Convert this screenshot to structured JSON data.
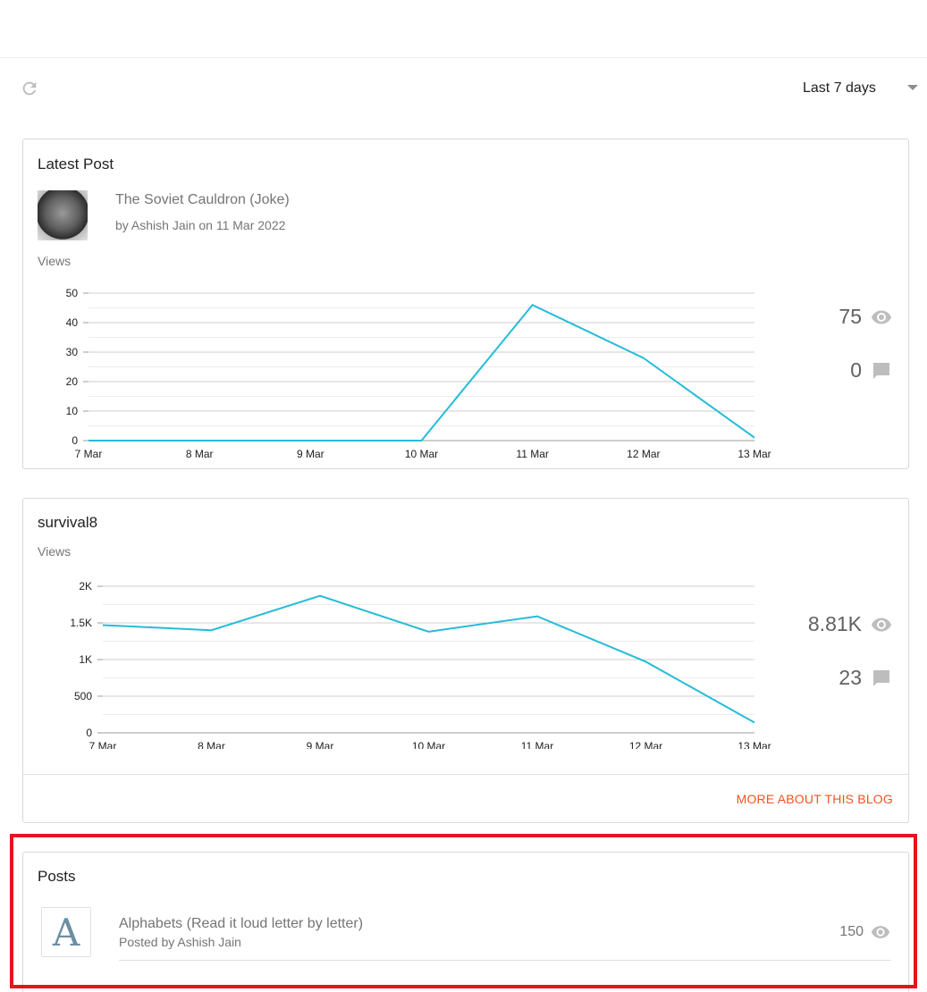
{
  "toolbar": {
    "refresh_icon": "refresh-icon",
    "date_range": "Last 7 days"
  },
  "latest_post": {
    "card_title": "Latest Post",
    "post_title": "The Soviet Cauldron (Joke)",
    "post_meta": "by Ashish Jain on 11 Mar 2022",
    "views_label": "Views",
    "total_views": "75",
    "total_comments": "0"
  },
  "blog": {
    "card_title": "survival8",
    "views_label": "Views",
    "total_views": "8.81K",
    "total_comments": "23",
    "more_link": "More about this blog"
  },
  "posts": {
    "card_title": "Posts",
    "avatar_letter": "A",
    "items": [
      {
        "title": "Alphabets (Read it loud letter by letter)",
        "meta": "Posted by Ashish Jain",
        "views": "150"
      }
    ]
  },
  "colors": {
    "line": "#26bcd7",
    "accent_link": "#f4511e",
    "highlight": "#e3141e"
  },
  "chart_data": [
    {
      "type": "line",
      "categories": [
        "7 Mar",
        "8 Mar",
        "9 Mar",
        "10 Mar",
        "11 Mar",
        "12 Mar",
        "13 Mar"
      ],
      "series": [
        {
          "values": [
            0,
            0,
            0,
            0,
            46,
            28,
            1
          ]
        }
      ],
      "ylabel": "Views",
      "ylim": [
        0,
        50
      ],
      "yticks": [
        0,
        10,
        20,
        30,
        40,
        50
      ],
      "ytick_labels": [
        "0",
        "10",
        "20",
        "30",
        "40",
        "50"
      ],
      "grid": true
    },
    {
      "type": "line",
      "categories": [
        "7 Mar",
        "8 Mar",
        "9 Mar",
        "10 Mar",
        "11 Mar",
        "12 Mar",
        "13 Mar"
      ],
      "series": [
        {
          "values": [
            1470,
            1400,
            1870,
            1380,
            1590,
            970,
            140
          ]
        }
      ],
      "ylabel": "Views",
      "ylim": [
        0,
        2000
      ],
      "yticks": [
        0,
        500,
        1000,
        1500,
        2000
      ],
      "ytick_labels": [
        "0",
        "500",
        "1K",
        "1.5K",
        "2K"
      ],
      "grid": true
    }
  ]
}
